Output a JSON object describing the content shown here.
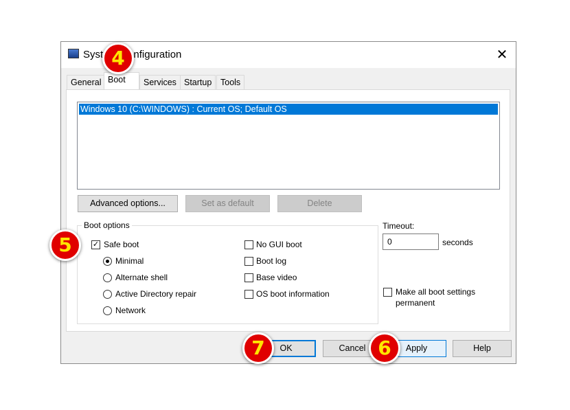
{
  "window": {
    "title": "System Configuration",
    "close": "✕"
  },
  "tabs": [
    "General",
    "Boot",
    "Services",
    "Startup",
    "Tools"
  ],
  "boot_list": {
    "items": [
      "Windows 10 (C:\\WINDOWS) : Current OS; Default OS"
    ]
  },
  "buttons": {
    "advanced": "Advanced options...",
    "set_default": "Set as default",
    "delete": "Delete",
    "ok": "OK",
    "cancel": "Cancel",
    "apply": "Apply",
    "help": "Help"
  },
  "boot_options": {
    "label": "Boot options",
    "safe_boot": "Safe boot",
    "minimal": "Minimal",
    "alternate_shell": "Alternate shell",
    "ad_repair": "Active Directory repair",
    "network": "Network",
    "no_gui": "No GUI boot",
    "boot_log": "Boot log",
    "base_video": "Base video",
    "os_info": "OS boot information",
    "check": "✓"
  },
  "timeout": {
    "label": "Timeout:",
    "value": "0",
    "unit": "seconds"
  },
  "permanent": {
    "line1": "Make all boot settings",
    "line2": "permanent"
  },
  "badges": [
    "4",
    "5",
    "6",
    "7"
  ]
}
